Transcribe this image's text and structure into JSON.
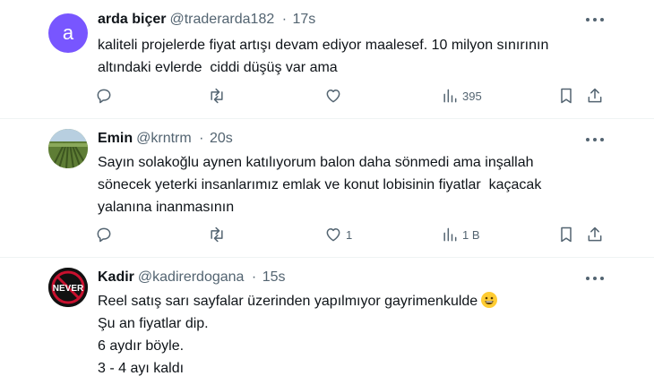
{
  "tweets": [
    {
      "avatar_letter": "a",
      "name": "arda biçer",
      "handle": "@traderarda182",
      "sep": "·",
      "time": "17s",
      "lines": [
        "kaliteli projelerde fiyat artışı devam ediyor maalesef. 10 milyon sınırının",
        "altındaki evlerde  ciddi düşüş var ama"
      ],
      "actions": {
        "reply": "",
        "retweet": "",
        "like": "",
        "views": "395"
      }
    },
    {
      "name": "Emin",
      "handle": "@krntrm",
      "sep": "·",
      "time": "20s",
      "lines": [
        "Sayın solakoğlu aynen katılıyorum balon daha sönmedi ama inşallah",
        "sönecek yeterki insanlarımız emlak ve konut lobisinin fiyatlar  kaçacak",
        "yalanına inanmasının"
      ],
      "actions": {
        "reply": "",
        "retweet": "",
        "like": "1",
        "views": "1 B"
      }
    },
    {
      "avatar_text": "NEVER",
      "name": "Kadir",
      "handle": "@kadirerdogana",
      "sep": "·",
      "time": "15s",
      "lines": [
        "Reel satış sarı sayfalar üzerinden yapılmıyor gayrimenkulde",
        "Şu an fiyatlar dip.",
        "6 aydır böyle.",
        "3 - 4 ayı kaldı"
      ],
      "emoji": "grinning-face-emoji"
    }
  ],
  "colors": {
    "text": "#0f1419",
    "muted": "#536471",
    "divider": "#eff3f4",
    "avatar_a": "#7856ff"
  }
}
